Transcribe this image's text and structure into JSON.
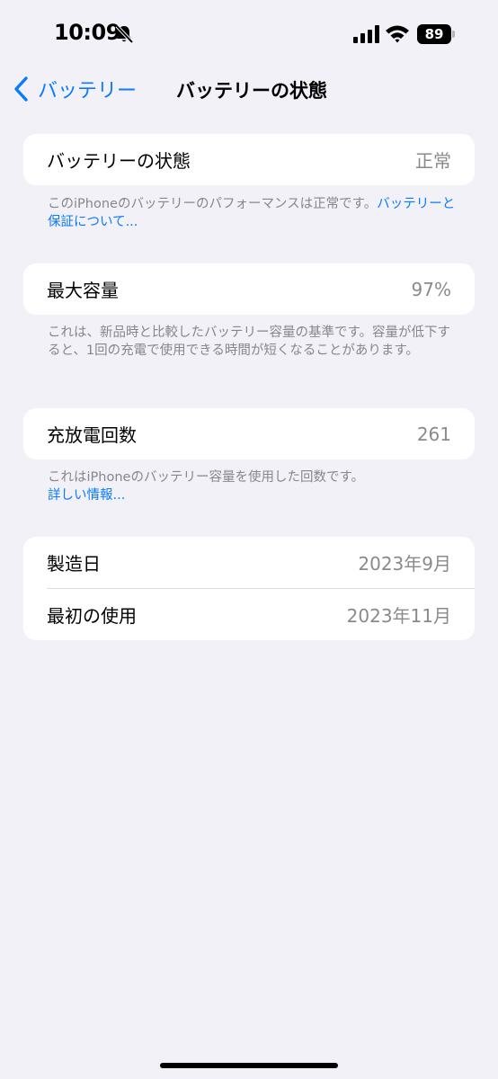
{
  "status_bar": {
    "time": "10:09",
    "battery_percent": "89",
    "icons": [
      "bell-slash-icon",
      "cellular-signal-icon",
      "wifi-icon",
      "battery-icon"
    ]
  },
  "nav": {
    "back_label": "バッテリー",
    "title": "バッテリーの状態"
  },
  "health": {
    "label": "バッテリーの状態",
    "value": "正常",
    "footnote_text": "このiPhoneのバッテリーのパフォーマンスは正常です。",
    "footnote_link": "バッテリーと保証について..."
  },
  "capacity": {
    "label": "最大容量",
    "value": "97%",
    "footnote_text": "これは、新品時と比較したバッテリー容量の基準です。容量が低下すると、1回の充電で使用できる時間が短くなることがあります。"
  },
  "cycles": {
    "label": "充放電回数",
    "value": "261",
    "footnote_text": "これはiPhoneのバッテリー容量を使用した回数です。",
    "footnote_link": "詳しい情報..."
  },
  "dates": {
    "manufactured_label": "製造日",
    "manufactured_value": "2023年9月",
    "first_use_label": "最初の使用",
    "first_use_value": "2023年11月"
  },
  "colors": {
    "accent": "#0a7aff",
    "background": "#f2f1f7",
    "secondary_text": "#8a8a8e"
  }
}
